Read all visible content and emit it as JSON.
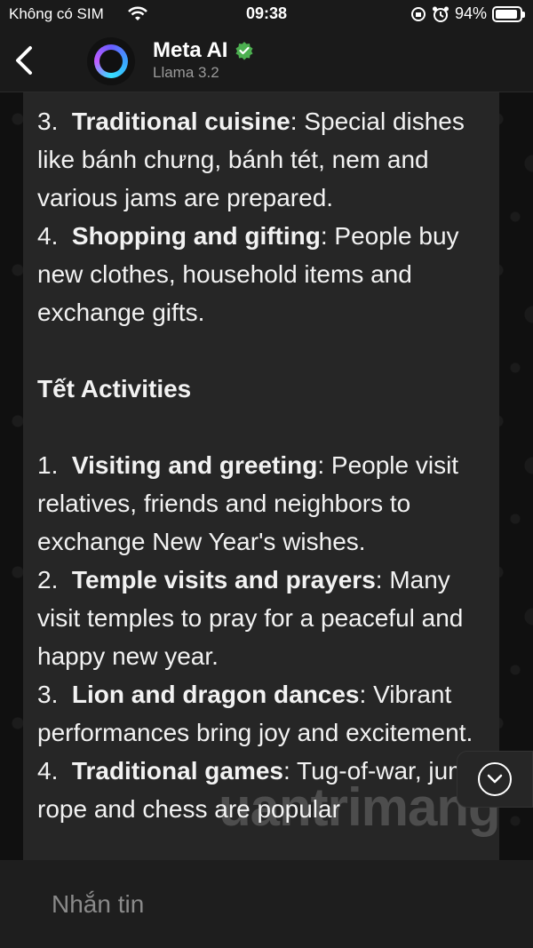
{
  "status_bar": {
    "carrier": "Không có SIM",
    "time": "09:38",
    "battery_percent": "94%",
    "battery_level": 0.94
  },
  "header": {
    "title": "Meta AI",
    "subtitle": "Llama 3.2"
  },
  "message": {
    "items": [
      {
        "num": "3.",
        "bold": "Traditional cuisine",
        "text": ": Special dishes like bánh chưng, bánh tét, nem and various jams are prepared."
      },
      {
        "num": "4.",
        "bold": "Shopping and gifting",
        "text": ": People buy new clothes, household items and exchange gifts."
      }
    ],
    "section_heading": "Tết Activities",
    "activities": [
      {
        "num": "1.",
        "bold": "Visiting and greeting",
        "text": ": People visit relatives, friends and neighbors to exchange New Year's wishes."
      },
      {
        "num": "2.",
        "bold": "Temple visits and prayers",
        "text": ": Many visit temples to pray for a peaceful and happy new year."
      },
      {
        "num": "3.",
        "bold": "Lion and dragon dances",
        "text": ": Vibrant performances bring joy and excitement."
      },
      {
        "num": "4.",
        "bold": "Traditional games",
        "text": ": Tug-of-war, jump rope and chess are popular"
      }
    ]
  },
  "watermark": "uantrimang",
  "composer": {
    "placeholder": "Nhắn tin"
  },
  "colors": {
    "bubble": "#262626",
    "verified": "#4caf50",
    "accent_ring": "#3aa3ff"
  }
}
